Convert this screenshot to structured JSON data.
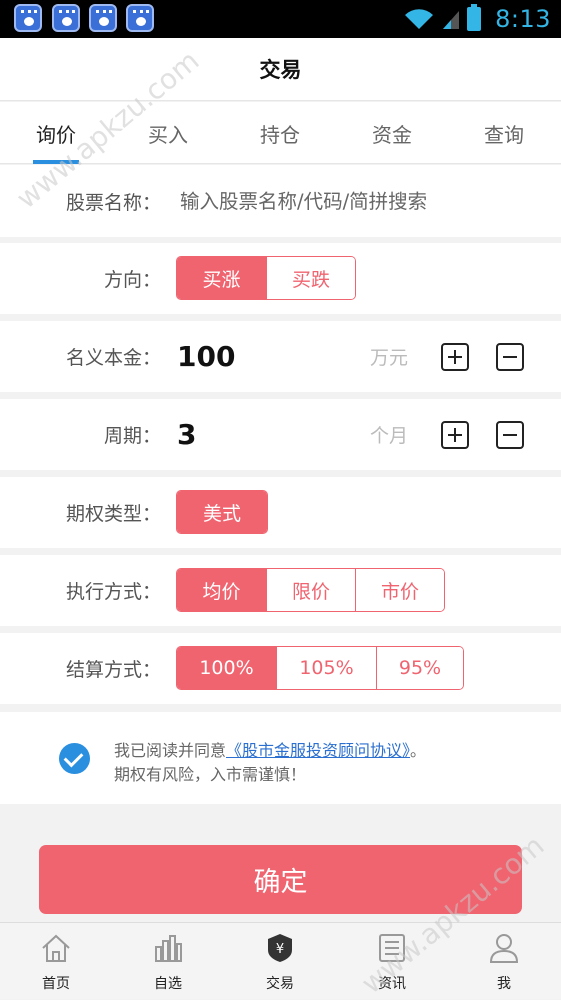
{
  "status_bar": {
    "time": "8:13"
  },
  "header": {
    "title": "交易"
  },
  "tabs": [
    "询价",
    "买入",
    "持仓",
    "资金",
    "查询"
  ],
  "form": {
    "stock_name": {
      "label": "股票名称：",
      "placeholder": "输入股票名称/代码/简拼搜索"
    },
    "direction": {
      "label": "方向：",
      "options": [
        "买涨",
        "买跌"
      ],
      "selected": "买涨"
    },
    "principal": {
      "label": "名义本金：",
      "value": "100",
      "unit": "万元"
    },
    "period": {
      "label": "周期：",
      "value": "3",
      "unit": "个月"
    },
    "option_type": {
      "label": "期权类型：",
      "options": [
        "美式"
      ],
      "selected": "美式"
    },
    "execution": {
      "label": "执行方式：",
      "options": [
        "均价",
        "限价",
        "市价"
      ],
      "selected": "均价"
    },
    "settlement": {
      "label": "结算方式：",
      "options": [
        "100%",
        "105%",
        "95%"
      ],
      "selected": "100%"
    }
  },
  "agreement": {
    "checked": true,
    "prefix": "我已阅读并同意",
    "link": "《股市金服投资顾问协议》",
    "suffix": "。",
    "warning": "期权有风险，入市需谨慎！"
  },
  "confirm_label": "确定",
  "bottom_nav": [
    {
      "label": "首页",
      "icon": "home-icon"
    },
    {
      "label": "自选",
      "icon": "chart-bars-icon"
    },
    {
      "label": "交易",
      "icon": "yuan-shield-icon"
    },
    {
      "label": "资讯",
      "icon": "news-icon"
    },
    {
      "label": "我",
      "icon": "person-icon"
    }
  ],
  "watermark": "www.apkzu.com",
  "colors": {
    "accent": "#f06470",
    "tab_indicator": "#2b8fe0",
    "status_accent": "#33b5e5"
  }
}
